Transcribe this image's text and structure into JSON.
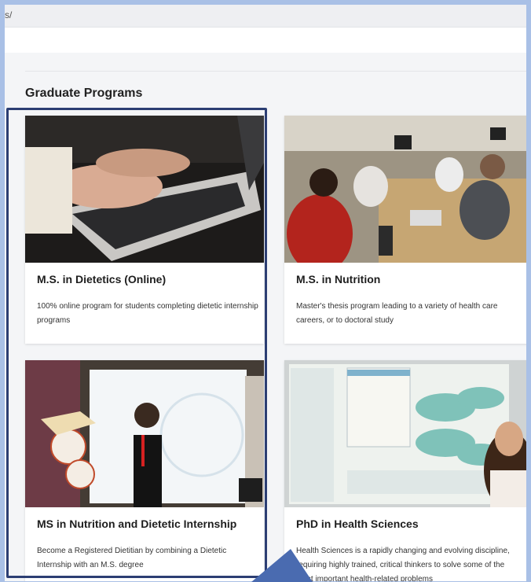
{
  "browser": {
    "url_fragment": "s/"
  },
  "section": {
    "title": "Graduate Programs"
  },
  "programs": [
    {
      "title": "M.S. in Dietetics (Online)",
      "description": "100% online program for students completing dietetic internship programs",
      "image": "laptop-typing-photo"
    },
    {
      "title": "M.S. in Nutrition",
      "description": "Master's thesis program leading to a variety of health care careers, or to doctoral study",
      "image": "students-classroom-photo"
    },
    {
      "title": "MS in Nutrition and Dietetic Internship",
      "description": "Become a Registered Dietitian by combining a Dietetic Internship with an M.S. degree",
      "image": "presenter-whiteboard-photo"
    },
    {
      "title": "PhD in Health Sciences",
      "description": "Health Sciences is a rapidly changing and evolving discipline, requiring highly trained, critical thinkers to solve some of the most important health-related problems",
      "image": "research-poster-photo"
    }
  ],
  "colors": {
    "highlight": "#2c3e73",
    "arrow": "#4a6bb0",
    "backdrop": "#a9c0e6"
  }
}
